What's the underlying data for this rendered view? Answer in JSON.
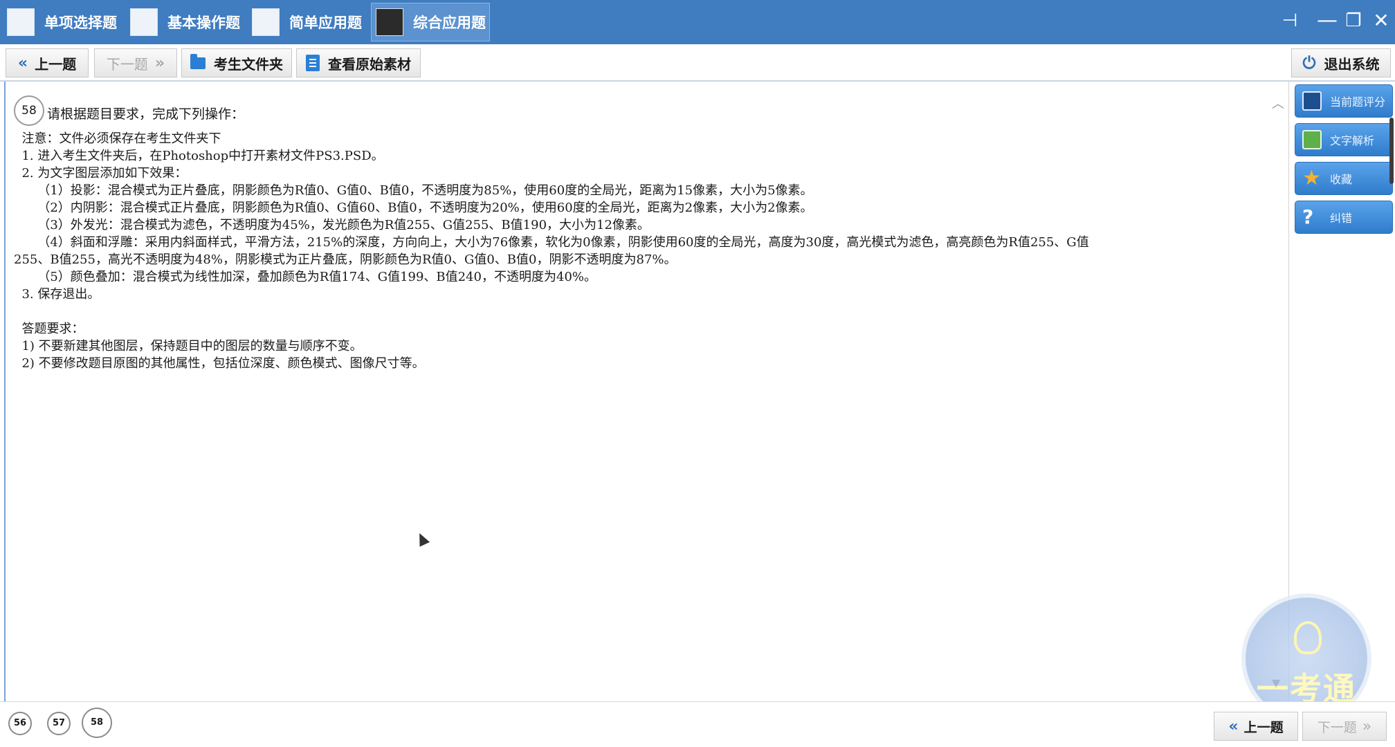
{
  "tabs": [
    {
      "label": "单项选择题",
      "icon": "list-icon"
    },
    {
      "label": "基本操作题",
      "icon": "grid-icon"
    },
    {
      "label": "简单应用题",
      "icon": "chart-icon"
    },
    {
      "label": "综合应用题",
      "icon": "waveform-icon"
    }
  ],
  "window_controls": {
    "pin": "⊣",
    "minimize": "—",
    "restore": "❐",
    "close": "✕"
  },
  "toolbar": {
    "prev_label": "上一题",
    "prev_glyph": "«",
    "next_label": "下一题",
    "next_glyph": "»",
    "folder_label": "考生文件夹",
    "material_label": "查看原始素材",
    "exit_label": "退出系统"
  },
  "question": {
    "number": "58",
    "heading": "请根据题目要求，完成下列操作：",
    "lines": [
      "  注意：文件必须保存在考生文件夹下",
      "  1. 进入考生文件夹后，在Photoshop中打开素材文件PS3.PSD。",
      "  2. 为文字图层添加如下效果：",
      "      （1）投影：混合模式为正片叠底，阴影颜色为R值0、G值0、B值0，不透明度为85%，使用60度的全局光，距离为15像素，大小为5像素。",
      "      （2）内阴影：混合模式正片叠底，阴影颜色为R值0、G值60、B值0，不透明度为20%，使用60度的全局光，距离为2像素，大小为2像素。",
      "      （3）外发光：混合模式为滤色，不透明度为45%，发光颜色为R值255、G值255、B值190，大小为12像素。",
      "      （4）斜面和浮雕：采用内斜面样式，平滑方法，215%的深度，方向向上，大小为76像素，软化为0像素，阴影使用60度的全局光，高度为30度，高光模式为滤色，高亮颜色为R值255、G值",
      "255、B值255，高光不透明度为48%，阴影模式为正片叠底，阴影颜色为R值0、G值0、B值0，阴影不透明度为87%。",
      "      （5）颜色叠加：混合模式为线性加深，叠加颜色为R值174、G值199、B值240，不透明度为40%。",
      "  3. 保存退出。",
      "",
      "  答题要求：",
      "  1) 不要新建其他图层，保持题目中的图层的数量与顺序不变。",
      "  2) 不要修改题目原图的其他属性，包括位深度、颜色模式、图像尺寸等。"
    ]
  },
  "side_buttons": [
    {
      "label": "当前题评分",
      "icon": "save-icon"
    },
    {
      "label": "文字解析",
      "icon": "note-icon"
    },
    {
      "label": "收藏",
      "icon": "star-icon"
    },
    {
      "label": "纠错",
      "icon": "help-icon"
    }
  ],
  "logo": {
    "text": "一考通"
  },
  "nav_numbers": [
    "56",
    "57",
    "58"
  ],
  "bottom": {
    "prev_label": "上一题",
    "next_label": "下一题"
  }
}
